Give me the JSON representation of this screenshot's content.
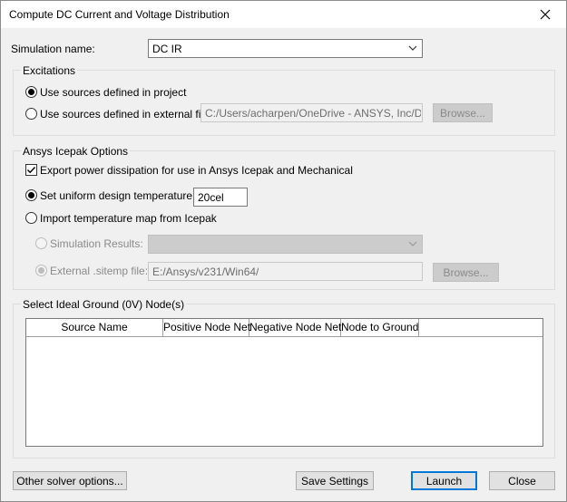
{
  "window": {
    "title": "Compute DC Current and Voltage Distribution"
  },
  "simulation": {
    "label": "Simulation name:",
    "value": "DC IR"
  },
  "excitations": {
    "title": "Excitations",
    "option_project": "Use sources defined in project",
    "option_external": "Use sources defined in external file",
    "file_path": "C:/Users/acharpen/OneDrive - ANSYS, Inc/Deskto",
    "browse_label": "Browse..."
  },
  "icepak": {
    "title": "Ansys Icepak Options",
    "export_label": "Export power dissipation for use in Ansys Icepak and Mechanical",
    "uniform_label": "Set uniform design temperature to",
    "uniform_value": "20cel",
    "import_label": "Import temperature map from Icepak",
    "sim_results_label": "Simulation Results:",
    "sim_results_value": "",
    "sitemp_label": "External .sitemp file:",
    "sitemp_value": "E:/Ansys/v231/Win64/",
    "browse_label": "Browse..."
  },
  "ground": {
    "title": "Select Ideal Ground (0V) Node(s)",
    "columns": [
      "Source Name",
      "Positive Node Net",
      "Negative Node Net",
      "Node to Ground"
    ],
    "rows": []
  },
  "footer": {
    "other_label": "Other solver options...",
    "save_label": "Save Settings",
    "launch_label": "Launch",
    "close_label": "Close"
  },
  "state": {
    "excitation_choice": "project",
    "export_checked": true,
    "temperature_choice": "uniform",
    "icepak_choice": "sitemp"
  }
}
